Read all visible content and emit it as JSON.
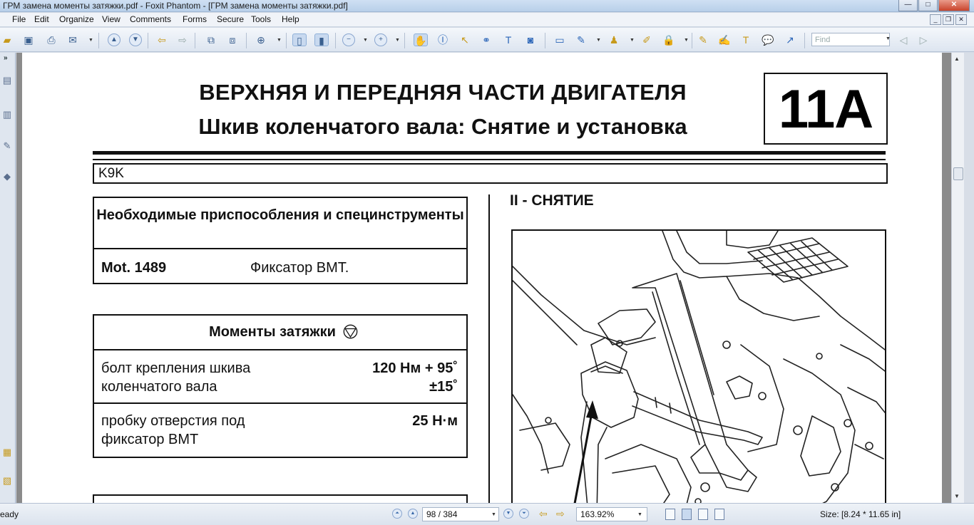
{
  "window": {
    "title": "ГРМ замена моменты затяжки.pdf - Foxit Phantom - [ГРМ замена моменты затяжки.pdf]",
    "controls": {
      "minimize": "—",
      "maximize": "□",
      "close": "✕"
    }
  },
  "menu": {
    "items": [
      "File",
      "Edit",
      "Organize",
      "View",
      "Comments",
      "Forms",
      "Secure",
      "Tools",
      "Help"
    ]
  },
  "toolbar": {
    "find_placeholder": "Find"
  },
  "document": {
    "title_line1": "ВЕРХНЯЯ И ПЕРЕДНЯЯ ЧАСТИ ДВИГАТЕЛЯ",
    "title_line2": "Шкив коленчатого вала: Снятие и установка",
    "section_code": "11A",
    "engine_code": "K9K",
    "tools_table": {
      "header": "Необходимые приспособления и специнструменты",
      "rows": [
        {
          "code": "Mot. 1489",
          "name": "Фиксатор ВМТ."
        }
      ]
    },
    "torque_table": {
      "header": "Моменты затяжки",
      "rows": [
        {
          "desc_line1": "болт крепления  шкива",
          "desc_line2": "коленчатого вала",
          "value_line1": "120 Нм + 95˚",
          "value_line2": "±15˚"
        },
        {
          "desc_line1": "пробку  отверстия под",
          "desc_line2": "фиксатор ВМТ",
          "value_line1": "25 Н·м",
          "value_line2": ""
        }
      ]
    },
    "removal_heading": "II - СНЯТИЕ"
  },
  "statusbar": {
    "status": "eady",
    "page_indicator": "98 / 384",
    "zoom": "163.92%",
    "page_size": "Size: [8.24 * 11.65 in]"
  }
}
